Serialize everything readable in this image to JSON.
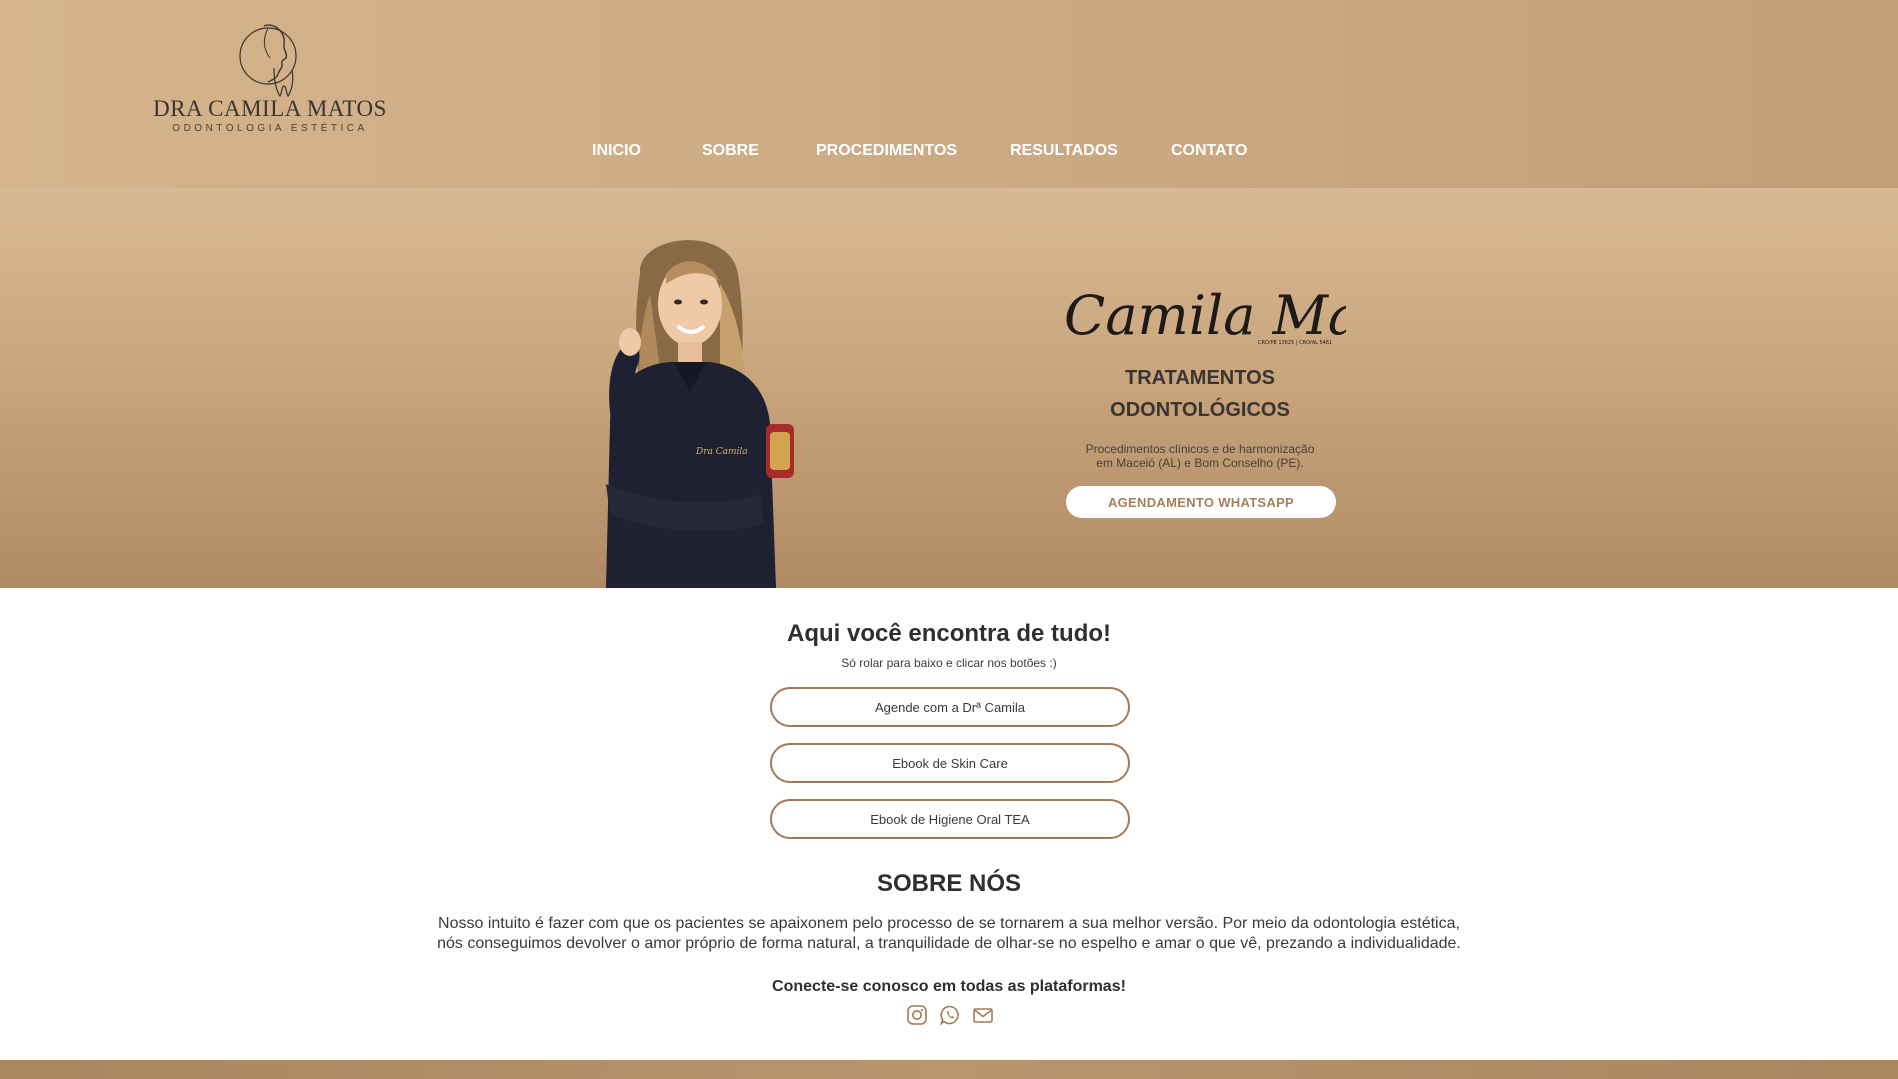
{
  "header": {
    "logo": {
      "name": "DRA CAMILA MATOS",
      "subtitle": "ODONTOLOGIA ESTÉTICA",
      "icon": "tooth-face-logo-icon"
    },
    "nav": [
      "INICIO",
      "SOBRE",
      "PROCEDIMENTOS",
      "RESULTADOS",
      "CONTATO"
    ]
  },
  "hero": {
    "signature": "Camila Matos",
    "signature_small": "CRO/PE 13625 | CRO/AL 5461",
    "title_line1": "TRATAMENTOS",
    "title_line2": "ODONTOLÓGICOS",
    "desc_line1": "Procedimentos clínicos e de harmonização",
    "desc_line2": "em Maceió (AL) e Bom Conselho (PE).",
    "cta": "AGENDAMENTO WHATSAPP"
  },
  "links": {
    "title": "Aqui você encontra de tudo!",
    "subtitle": "Só rolar para baixo e clicar nos botões :)",
    "buttons": [
      "Agende com a Drª Camila",
      "Ebook de Skin Care",
      "Ebook de Higiene Oral TEA"
    ]
  },
  "about": {
    "title": "SOBRE NÓS",
    "line1": "Nosso intuito é fazer com que os pacientes se apaixonem pelo processo de se tornarem a sua melhor versão. Por meio da odontologia estética,",
    "line2": "nós conseguimos devolver o amor próprio de forma natural, a tranquilidade de olhar-se no espelho e amar o que vê, prezando a individualidade.",
    "connect": "Conecte-se conosco em todas as plataformas!",
    "socials": [
      "instagram-icon",
      "whatsapp-icon",
      "email-icon"
    ]
  },
  "colors": {
    "accent": "#a27a55",
    "header_bg": "#d5b48c",
    "hero_bottom": "#b08a64",
    "text": "#2f2f2f"
  }
}
